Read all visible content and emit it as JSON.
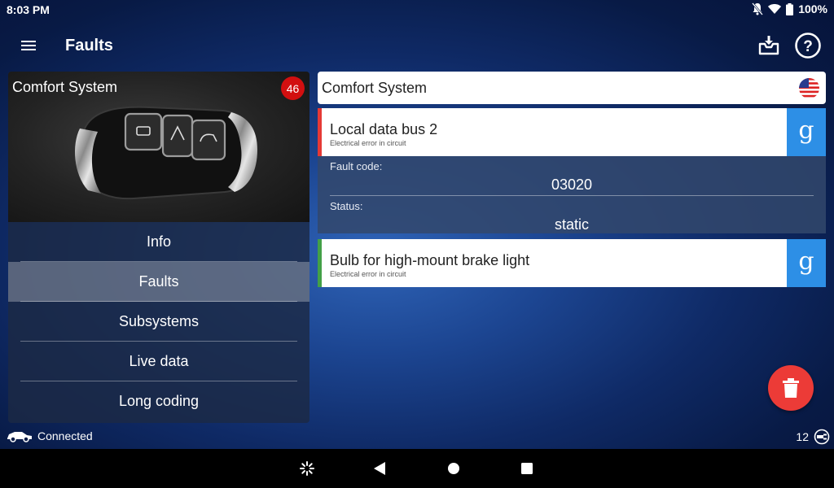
{
  "status_bar": {
    "time": "8:03 PM",
    "battery": "100%",
    "icons": [
      "mute-icon",
      "wifi-icon",
      "battery-icon"
    ]
  },
  "app_bar": {
    "title": "Faults",
    "icons": [
      "menu-icon",
      "inbox-download-icon",
      "help-icon"
    ]
  },
  "module": {
    "name": "Comfort System",
    "fault_count": "46"
  },
  "nav": {
    "items": [
      {
        "label": "Info"
      },
      {
        "label": "Faults"
      },
      {
        "label": "Subsystems"
      },
      {
        "label": "Live data"
      },
      {
        "label": "Long coding"
      }
    ],
    "active": "Faults"
  },
  "detail_header": {
    "title": "Comfort System",
    "flag_icon": "us-flag-icon"
  },
  "faults": [
    {
      "title": "Local data bus 2",
      "subtitle": "Electrical error in circuit",
      "stripe_color": "#e53935",
      "search_glyph": "g",
      "expanded": {
        "fault_code_label": "Fault code:",
        "fault_code": "03020",
        "status_label": "Status:",
        "status": "static"
      }
    },
    {
      "title": "Bulb for high-mount brake light",
      "subtitle": "Electrical error in circuit",
      "stripe_color": "#43a047",
      "search_glyph": "g"
    }
  ],
  "footer": {
    "connection": "Connected",
    "count": "12"
  },
  "colors": {
    "accent_blue": "#2d8fe6",
    "fab_red": "#ec3b37",
    "badge_red": "#d20f10"
  }
}
